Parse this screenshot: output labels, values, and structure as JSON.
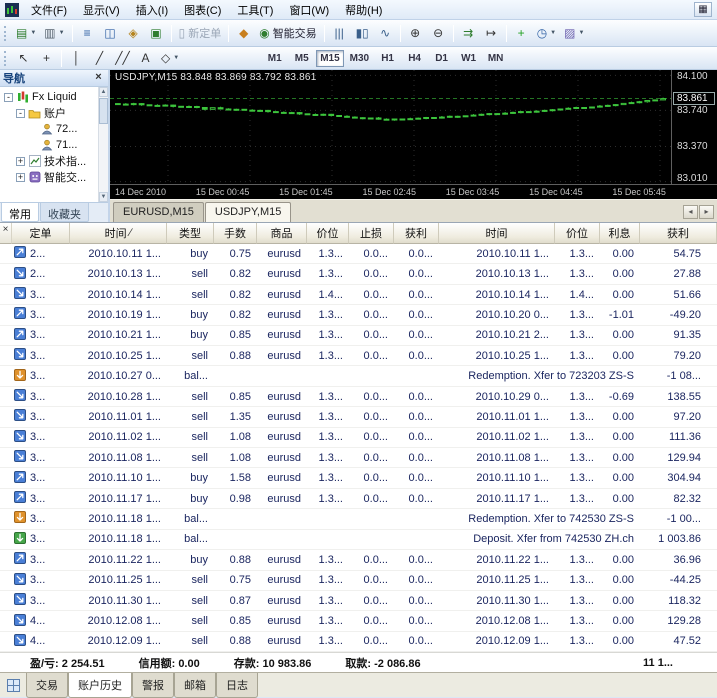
{
  "menu_bar": {
    "items": [
      {
        "name": "menu-file",
        "label": "文件(F)"
      },
      {
        "name": "menu-view",
        "label": "显示(V)"
      },
      {
        "name": "menu-insert",
        "label": "插入(I)"
      },
      {
        "name": "menu-charts",
        "label": "图表(C)"
      },
      {
        "name": "menu-tools",
        "label": "工具(T)"
      },
      {
        "name": "menu-window",
        "label": "窗口(W)"
      },
      {
        "name": "menu-help",
        "label": "帮助(H)"
      }
    ]
  },
  "toolbar_standard": {
    "buttons": [
      {
        "name": "new-chart-button",
        "glyph": "▤",
        "color": "#2f7d2f",
        "caret": true
      },
      {
        "name": "profiles-button",
        "glyph": "▥",
        "color": "#57636f",
        "caret": true
      },
      {
        "sep": true
      },
      {
        "name": "market-watch-button",
        "glyph": "≡",
        "color": "#2e5fa3"
      },
      {
        "name": "data-window-button",
        "glyph": "◫",
        "color": "#2e5fa3"
      },
      {
        "name": "navigator-button",
        "glyph": "◈",
        "color": "#b5841f"
      },
      {
        "name": "terminal-button",
        "glyph": "▣",
        "color": "#2f7d2f"
      },
      {
        "sep": true
      },
      {
        "name": "new-order-button",
        "glyph": "▯",
        "color": "#8d99a8",
        "label": "新定单",
        "disabled": true
      },
      {
        "sep": true
      },
      {
        "name": "metaeditor-button",
        "glyph": "◆",
        "color": "#c87f1e"
      },
      {
        "name": "expert-advisors-button",
        "glyph": "◉",
        "color": "#2f7d2f",
        "label": "智能交易"
      },
      {
        "sep": true
      },
      {
        "name": "chart-bars-button",
        "glyph": "|||",
        "color": "#3a5f8a"
      },
      {
        "name": "chart-candles-button",
        "glyph": "▮▯",
        "color": "#3a5f8a"
      },
      {
        "name": "chart-line-button",
        "glyph": "∿",
        "color": "#3a5f8a"
      },
      {
        "sep": true
      },
      {
        "name": "zoom-in-button",
        "glyph": "⊕",
        "color": "#333333"
      },
      {
        "name": "zoom-out-button",
        "glyph": "⊖",
        "color": "#333333"
      },
      {
        "sep": true
      },
      {
        "name": "auto-scroll-button",
        "glyph": "⇉",
        "color": "#2f7d2f"
      },
      {
        "name": "chart-shift-button",
        "glyph": "↦",
        "color": "#333333"
      },
      {
        "sep": true
      },
      {
        "name": "indicators-button",
        "glyph": "+",
        "color": "#23a123"
      },
      {
        "name": "periods-button",
        "glyph": "◷",
        "color": "#2e5fa3",
        "caret": true
      },
      {
        "name": "templates-button",
        "glyph": "▨",
        "color": "#6b5fae",
        "caret": true
      }
    ]
  },
  "toolbar_charts": {
    "buttons": [
      {
        "name": "cursor-button",
        "glyph": "↖",
        "color": "#333333"
      },
      {
        "name": "crosshair-button",
        "glyph": "+",
        "color": "#333333"
      },
      {
        "sep": true
      },
      {
        "name": "vertical-line-button",
        "glyph": "│",
        "color": "#333333"
      },
      {
        "name": "trendline-button",
        "glyph": "╱",
        "color": "#333333"
      },
      {
        "name": "equidistant-channel-button",
        "glyph": "╱╱",
        "color": "#333333"
      },
      {
        "name": "text-button",
        "glyph": "A",
        "color": "#333333"
      },
      {
        "name": "arrows-button",
        "glyph": "◇",
        "color": "#333333",
        "caret": true
      }
    ],
    "periods": [
      "M1",
      "M5",
      "M15",
      "M30",
      "H1",
      "H4",
      "D1",
      "W1",
      "MN"
    ],
    "active_period": "M15"
  },
  "navigator": {
    "title": "导航",
    "tree": [
      {
        "name": "nav-broker",
        "label": "Fx Liquid",
        "level": 0,
        "expand": "minus",
        "icon": "broker-icon"
      },
      {
        "name": "nav-accounts",
        "label": "账户",
        "level": 1,
        "expand": "minus",
        "icon": "accounts-icon"
      },
      {
        "name": "nav-account-72",
        "label": "72...",
        "level": 2,
        "expand": "none",
        "icon": "account-icon"
      },
      {
        "name": "nav-account-71",
        "label": "71...",
        "level": 2,
        "expand": "none",
        "icon": "account-icon"
      },
      {
        "name": "nav-indicators",
        "label": "技术指...",
        "level": 1,
        "expand": "plus",
        "icon": "indicators-icon"
      },
      {
        "name": "nav-experts",
        "label": "智能交...",
        "level": 1,
        "expand": "plus",
        "icon": "experts-icon"
      }
    ],
    "tabs": [
      {
        "name": "nav-tab-common",
        "label": "常用",
        "active": true
      },
      {
        "name": "nav-tab-favorites",
        "label": "收藏夹",
        "active": false
      }
    ]
  },
  "chart": {
    "title": "USDJPY,M15 83.848 83.869 83.792 83.861",
    "current_price": "83.861",
    "price_axis": [
      "84.100",
      "83.740",
      "83.370",
      "83.010"
    ],
    "time_axis": [
      "14 Dec 2010",
      "15 Dec 00:45",
      "15 Dec 01:45",
      "15 Dec 02:45",
      "15 Dec 03:45",
      "15 Dec 04:45",
      "15 Dec 05:45"
    ],
    "colors": {
      "background": "#000000",
      "bull": "#3cc43c",
      "grid": "#2e2e2e"
    },
    "chart_data": {
      "type": "candlestick",
      "symbol": "USDJPY",
      "timeframe": "M15",
      "last_ohlc": {
        "open": 83.848,
        "high": 83.869,
        "low": 83.792,
        "close": 83.861
      },
      "price_range": [
        83.01,
        84.1
      ],
      "closes": [
        83.805,
        83.8,
        83.81,
        83.798,
        83.792,
        83.788,
        83.795,
        83.782,
        83.775,
        83.78,
        83.77,
        83.752,
        83.768,
        83.755,
        83.748,
        83.752,
        83.742,
        83.735,
        83.74,
        83.728,
        83.72,
        83.712,
        83.718,
        83.705,
        83.698,
        83.692,
        83.7,
        83.688,
        83.68,
        83.672,
        83.665,
        83.658,
        83.662,
        83.65,
        83.645,
        83.652,
        83.648,
        83.655,
        83.66,
        83.668,
        83.662,
        83.672,
        83.68,
        83.675,
        83.685,
        83.692,
        83.7,
        83.708,
        83.702,
        83.712,
        83.72,
        83.728,
        83.722,
        83.732,
        83.74,
        83.748,
        83.755,
        83.762,
        83.77,
        83.765,
        83.775,
        83.785,
        83.792,
        83.8,
        83.812,
        83.82,
        83.83,
        83.842,
        83.848,
        83.861
      ]
    }
  },
  "chart_tabs": {
    "tabs": [
      {
        "name": "chart-tab-eurusd",
        "label": "EURUSD,M15",
        "active": false
      },
      {
        "name": "chart-tab-usdjpy",
        "label": "USDJPY,M15",
        "active": true
      }
    ]
  },
  "terminal": {
    "headers": [
      "定单",
      "时间",
      "类型",
      "手数",
      "商品",
      "价位",
      "止损",
      "获利",
      "时间",
      "价位",
      "利息",
      "获利"
    ],
    "sorted_column": 1,
    "sort_glyph": "∕",
    "rows": [
      {
        "kind": "trade",
        "icon": "buy",
        "order": "2...",
        "open_time": "2010.10.11 1...",
        "type": "buy",
        "lots": "0.75",
        "symbol": "eurusd",
        "open_price": "1.3...",
        "sl": "0.0...",
        "tp": "0.0...",
        "close_time": "2010.10.11 1...",
        "close_price": "1.3...",
        "swap": "0.00",
        "profit": "54.75"
      },
      {
        "kind": "trade",
        "icon": "sell",
        "order": "2...",
        "open_time": "2010.10.13 1...",
        "type": "sell",
        "lots": "0.82",
        "symbol": "eurusd",
        "open_price": "1.3...",
        "sl": "0.0...",
        "tp": "0.0...",
        "close_time": "2010.10.13 1...",
        "close_price": "1.3...",
        "swap": "0.00",
        "profit": "27.88"
      },
      {
        "kind": "trade",
        "icon": "sell",
        "order": "3...",
        "open_time": "2010.10.14 1...",
        "type": "sell",
        "lots": "0.82",
        "symbol": "eurusd",
        "open_price": "1.4...",
        "sl": "0.0...",
        "tp": "0.0...",
        "close_time": "2010.10.14 1...",
        "close_price": "1.4...",
        "swap": "0.00",
        "profit": "51.66"
      },
      {
        "kind": "trade",
        "icon": "buy",
        "order": "3...",
        "open_time": "2010.10.19 1...",
        "type": "buy",
        "lots": "0.82",
        "symbol": "eurusd",
        "open_price": "1.3...",
        "sl": "0.0...",
        "tp": "0.0...",
        "close_time": "2010.10.20 0...",
        "close_price": "1.3...",
        "swap": "-1.01",
        "profit": "-49.20"
      },
      {
        "kind": "trade",
        "icon": "buy",
        "order": "3...",
        "open_time": "2010.10.21 1...",
        "type": "buy",
        "lots": "0.85",
        "symbol": "eurusd",
        "open_price": "1.3...",
        "sl": "0.0...",
        "tp": "0.0...",
        "close_time": "2010.10.21 2...",
        "close_price": "1.3...",
        "swap": "0.00",
        "profit": "91.35"
      },
      {
        "kind": "trade",
        "icon": "sell",
        "order": "3...",
        "open_time": "2010.10.25 1...",
        "type": "sell",
        "lots": "0.88",
        "symbol": "eurusd",
        "open_price": "1.3...",
        "sl": "0.0...",
        "tp": "0.0...",
        "close_time": "2010.10.25 1...",
        "close_price": "1.3...",
        "swap": "0.00",
        "profit": "79.20"
      },
      {
        "kind": "balance",
        "icon": "withdrawal",
        "order": "3...",
        "open_time": "2010.10.27 0...",
        "type": "bal...",
        "comment": "Redemption. Xfer to 723203 ZS-S",
        "profit": "-1 08..."
      },
      {
        "kind": "trade",
        "icon": "sell",
        "order": "3...",
        "open_time": "2010.10.28 1...",
        "type": "sell",
        "lots": "0.85",
        "symbol": "eurusd",
        "open_price": "1.3...",
        "sl": "0.0...",
        "tp": "0.0...",
        "close_time": "2010.10.29 0...",
        "close_price": "1.3...",
        "swap": "-0.69",
        "profit": "138.55"
      },
      {
        "kind": "trade",
        "icon": "sell",
        "order": "3...",
        "open_time": "2010.11.01 1...",
        "type": "sell",
        "lots": "1.35",
        "symbol": "eurusd",
        "open_price": "1.3...",
        "sl": "0.0...",
        "tp": "0.0...",
        "close_time": "2010.11.01 1...",
        "close_price": "1.3...",
        "swap": "0.00",
        "profit": "97.20"
      },
      {
        "kind": "trade",
        "icon": "sell",
        "order": "3...",
        "open_time": "2010.11.02 1...",
        "type": "sell",
        "lots": "1.08",
        "symbol": "eurusd",
        "open_price": "1.3...",
        "sl": "0.0...",
        "tp": "0.0...",
        "close_time": "2010.11.02 1...",
        "close_price": "1.3...",
        "swap": "0.00",
        "profit": "111.36"
      },
      {
        "kind": "trade",
        "icon": "sell",
        "order": "3...",
        "open_time": "2010.11.08 1...",
        "type": "sell",
        "lots": "1.08",
        "symbol": "eurusd",
        "open_price": "1.3...",
        "sl": "0.0...",
        "tp": "0.0...",
        "close_time": "2010.11.08 1...",
        "close_price": "1.3...",
        "swap": "0.00",
        "profit": "129.94"
      },
      {
        "kind": "trade",
        "icon": "buy",
        "order": "3...",
        "open_time": "2010.11.10 1...",
        "type": "buy",
        "lots": "1.58",
        "symbol": "eurusd",
        "open_price": "1.3...",
        "sl": "0.0...",
        "tp": "0.0...",
        "close_time": "2010.11.10 1...",
        "close_price": "1.3...",
        "swap": "0.00",
        "profit": "304.94"
      },
      {
        "kind": "trade",
        "icon": "buy",
        "order": "3...",
        "open_time": "2010.11.17 1...",
        "type": "buy",
        "lots": "0.98",
        "symbol": "eurusd",
        "open_price": "1.3...",
        "sl": "0.0...",
        "tp": "0.0...",
        "close_time": "2010.11.17 1...",
        "close_price": "1.3...",
        "swap": "0.00",
        "profit": "82.32"
      },
      {
        "kind": "balance",
        "icon": "withdrawal",
        "order": "3...",
        "open_time": "2010.11.18 1...",
        "type": "bal...",
        "comment": "Redemption. Xfer to 742530 ZS-S",
        "profit": "-1 00..."
      },
      {
        "kind": "balance",
        "icon": "deposit",
        "order": "3...",
        "open_time": "2010.11.18 1...",
        "type": "bal...",
        "comment": "Deposit. Xfer from 742530 ZH.ch",
        "profit": "1 003.86"
      },
      {
        "kind": "trade",
        "icon": "buy",
        "order": "3...",
        "open_time": "2010.11.22 1...",
        "type": "buy",
        "lots": "0.88",
        "symbol": "eurusd",
        "open_price": "1.3...",
        "sl": "0.0...",
        "tp": "0.0...",
        "close_time": "2010.11.22 1...",
        "close_price": "1.3...",
        "swap": "0.00",
        "profit": "36.96"
      },
      {
        "kind": "trade",
        "icon": "sell",
        "order": "3...",
        "open_time": "2010.11.25 1...",
        "type": "sell",
        "lots": "0.75",
        "symbol": "eurusd",
        "open_price": "1.3...",
        "sl": "0.0...",
        "tp": "0.0...",
        "close_time": "2010.11.25 1...",
        "close_price": "1.3...",
        "swap": "0.00",
        "profit": "-44.25"
      },
      {
        "kind": "trade",
        "icon": "sell",
        "order": "3...",
        "open_time": "2010.11.30 1...",
        "type": "sell",
        "lots": "0.87",
        "symbol": "eurusd",
        "open_price": "1.3...",
        "sl": "0.0...",
        "tp": "0.0...",
        "close_time": "2010.11.30 1...",
        "close_price": "1.3...",
        "swap": "0.00",
        "profit": "118.32"
      },
      {
        "kind": "trade",
        "icon": "sell",
        "order": "4...",
        "open_time": "2010.12.08 1...",
        "type": "sell",
        "lots": "0.85",
        "symbol": "eurusd",
        "open_price": "1.3...",
        "sl": "0.0...",
        "tp": "0.0...",
        "close_time": "2010.12.08 1...",
        "close_price": "1.3...",
        "swap": "0.00",
        "profit": "129.28"
      },
      {
        "kind": "trade",
        "icon": "sell",
        "order": "4...",
        "open_time": "2010.12.09 1...",
        "type": "sell",
        "lots": "0.88",
        "symbol": "eurusd",
        "open_price": "1.3...",
        "sl": "0.0...",
        "tp": "0.0...",
        "close_time": "2010.12.09 1...",
        "close_price": "1.3...",
        "swap": "0.00",
        "profit": "47.52"
      }
    ],
    "summary": {
      "items": [
        {
          "name": "profit",
          "label": "盈/亏:",
          "value": "2 254.51"
        },
        {
          "name": "credit",
          "label": "信用额:",
          "value": "0.00"
        },
        {
          "name": "deposit",
          "label": "存款:",
          "value": "10 983.86"
        },
        {
          "name": "withdrawal",
          "label": "取款:",
          "value": "-2 086.86"
        }
      ],
      "balance_text": "11 1..."
    },
    "tabs": [
      {
        "name": "tab-trade",
        "label": "交易",
        "active": false
      },
      {
        "name": "tab-account-history",
        "label": "账户历史",
        "active": true
      },
      {
        "name": "tab-alerts",
        "label": "警报",
        "active": false
      },
      {
        "name": "tab-mailbox",
        "label": "邮箱",
        "active": false
      },
      {
        "name": "tab-journal",
        "label": "日志",
        "active": false
      }
    ]
  }
}
